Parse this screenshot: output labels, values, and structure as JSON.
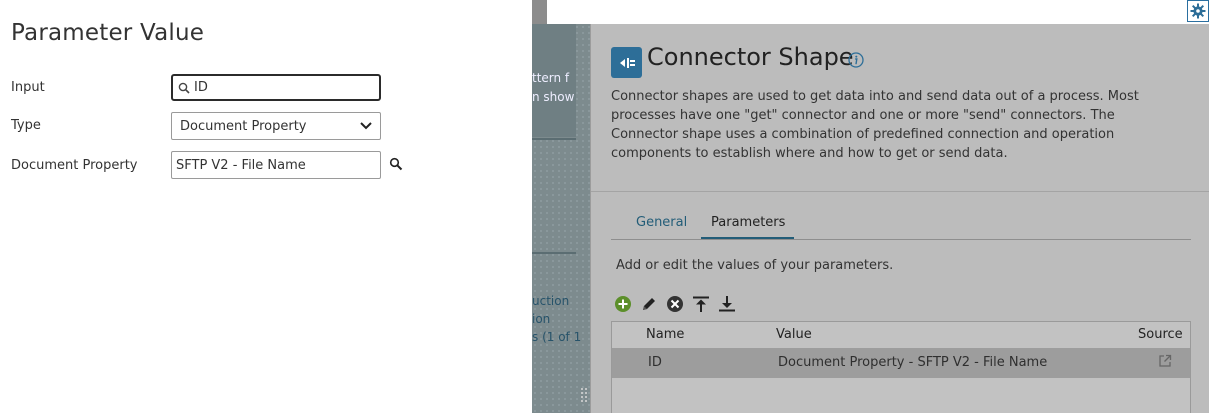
{
  "dialog": {
    "title": "Parameter Value",
    "input_label": "Input",
    "input_value": "ID",
    "type_label": "Type",
    "type_value": "Document Property",
    "docprop_label": "Document Property",
    "docprop_value": "SFTP V2 - File Name"
  },
  "canvas": {
    "line1": "ttern f",
    "line2": "n show",
    "line3": "uction",
    "line4": "ion",
    "line5": "s (1 of 1"
  },
  "panel": {
    "title": "Connector Shape",
    "description": "Connector shapes are used to get data into and send data out of a process. Most processes have one \"get\" connector and one or more \"send\" connectors. The Connector shape uses a combination of predefined connection and operation components to establish where and how to get or send data.",
    "tabs": [
      {
        "label": "General"
      },
      {
        "label": "Parameters"
      }
    ],
    "active_tab": "Parameters",
    "intro": "Add or edit the values of your parameters.",
    "table": {
      "headers": [
        "Name",
        "Value",
        "Source"
      ],
      "rows": [
        {
          "name": "ID",
          "value": "Document Property - SFTP V2 - File Name"
        }
      ]
    }
  },
  "colors": {
    "accent": "#2d6e98",
    "tab_active": "#235d78",
    "add_green": "#5c8f2a"
  },
  "icons": [
    "search-icon",
    "chevron-down-icon",
    "gear-icon",
    "connector-icon",
    "info-icon",
    "add-icon",
    "edit-icon",
    "delete-icon",
    "move-top-icon",
    "move-bottom-icon",
    "external-link-icon"
  ]
}
